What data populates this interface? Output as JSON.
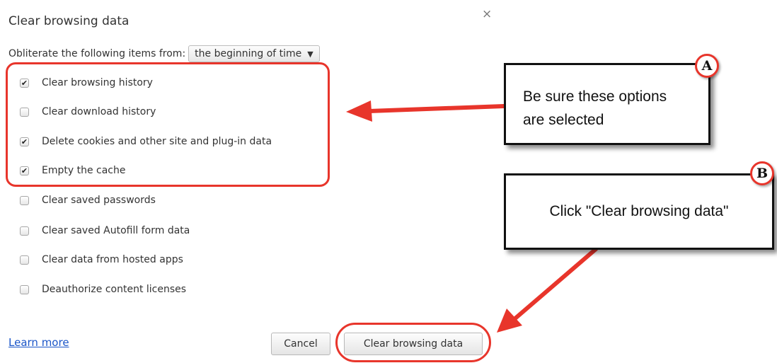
{
  "dialog": {
    "title": "Clear browsing data",
    "close_glyph": "×",
    "range_label": "Obliterate the following items from:",
    "range_value": "the beginning of time",
    "caret_glyph": "▼",
    "options": [
      {
        "label": "Clear browsing history",
        "checked": true
      },
      {
        "label": "Clear download history",
        "checked": false
      },
      {
        "label": "Delete cookies and other site and plug-in data",
        "checked": true
      },
      {
        "label": "Empty the cache",
        "checked": true
      },
      {
        "label": "Clear saved passwords",
        "checked": false
      },
      {
        "label": "Clear saved Autofill form data",
        "checked": false
      },
      {
        "label": "Clear data from hosted apps",
        "checked": false
      },
      {
        "label": "Deauthorize content licenses",
        "checked": false
      }
    ],
    "learn_more": "Learn more",
    "cancel_label": "Cancel",
    "clear_label": "Clear browsing data"
  },
  "annotations": {
    "callout_a": {
      "badge": "A",
      "text": "Be sure these options are selected"
    },
    "callout_b": {
      "badge": "B",
      "text": "Click \"Clear browsing data\""
    },
    "accent_color": "#e8352b"
  }
}
